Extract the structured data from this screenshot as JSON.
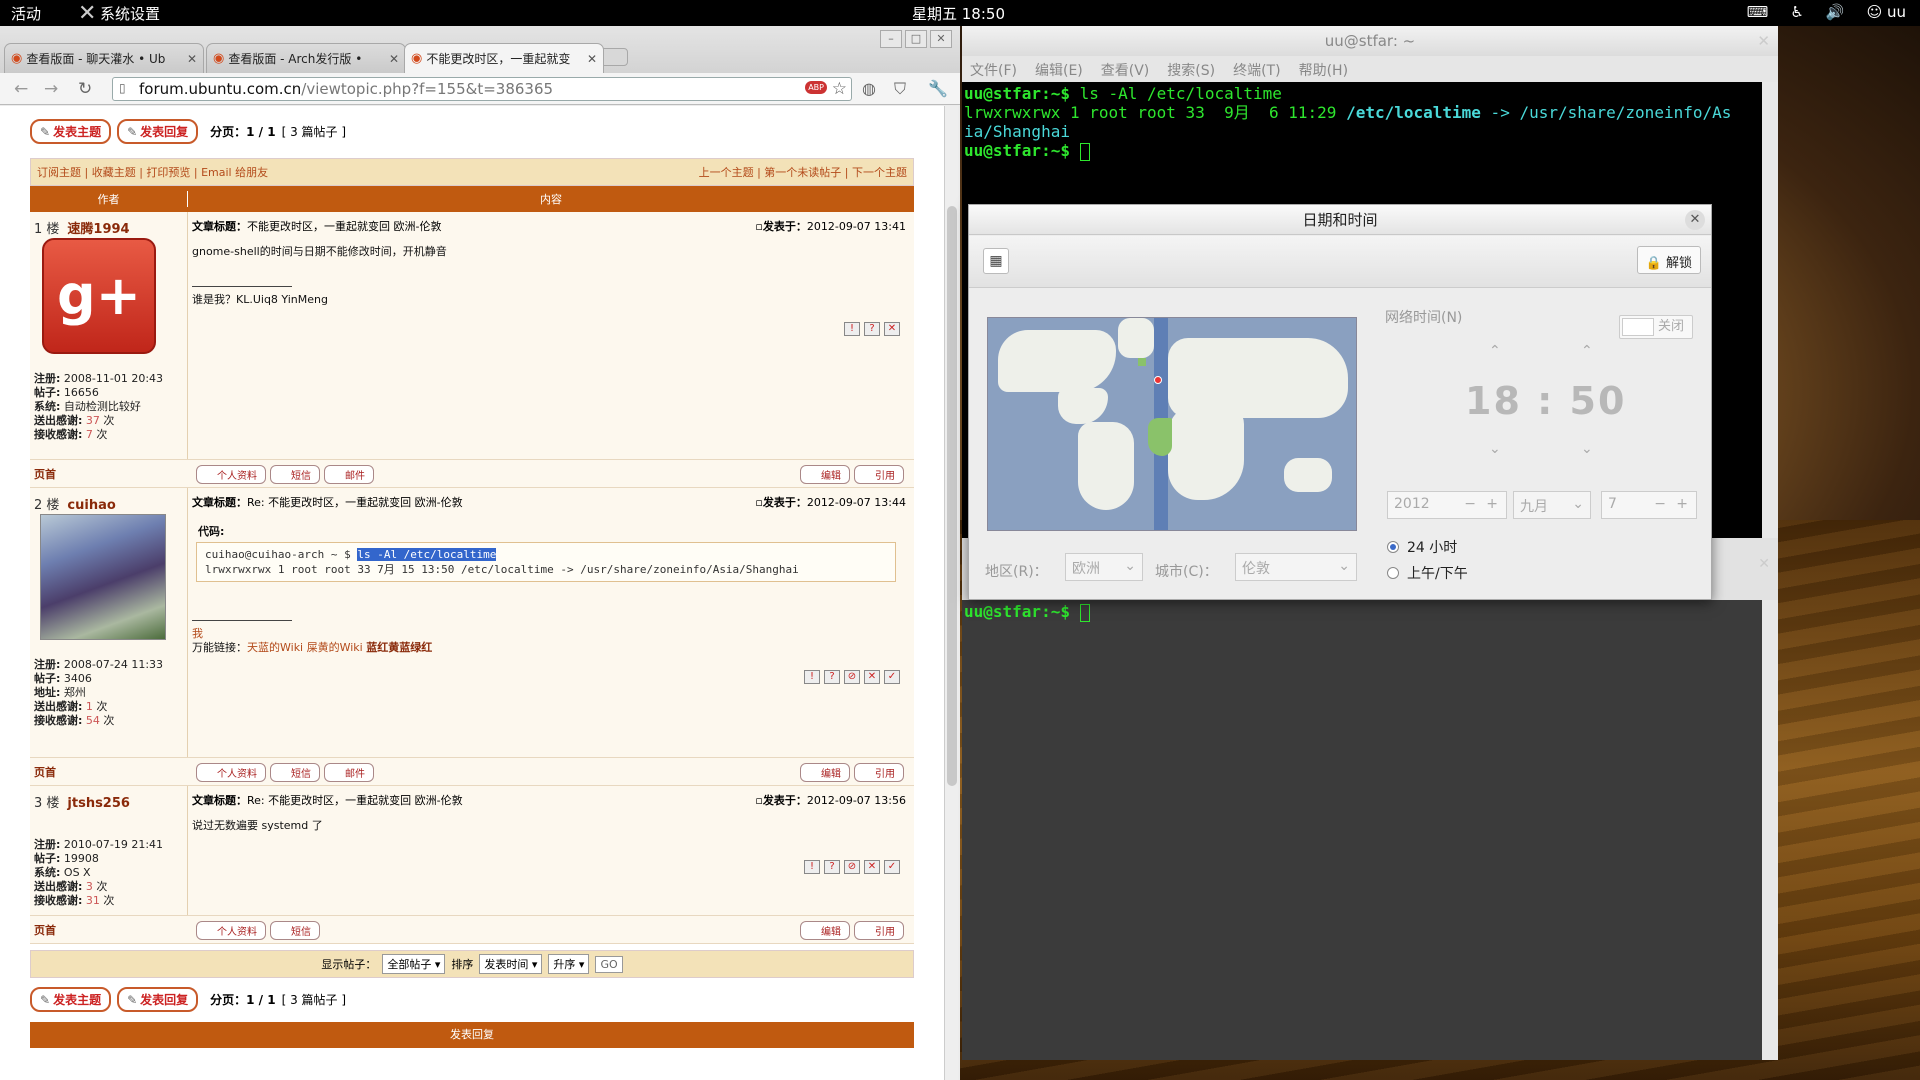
{
  "topbar": {
    "activities": "活动",
    "app_menu": "系统设置",
    "clock": "星期五 18:50",
    "user": "uu"
  },
  "browser": {
    "tabs": [
      {
        "label": "查看版面 - 聊天灌水 • Ub"
      },
      {
        "label": "查看版面 - Arch发行版 •"
      },
      {
        "label": "不能更改时区，一重起就变"
      }
    ],
    "url_host": "forum.ubuntu.com.cn",
    "url_path": "/viewtopic.php?f=155&t=386365"
  },
  "forum": {
    "new_topic": "发表主题",
    "reply": "发表回复",
    "pagination": "分页：1 / 1",
    "post_count": "[ 3 篇帖子 ]",
    "links_left": "订阅主题 | 收藏主题 | 打印预览 | Email 给朋友",
    "links_right": "上一个主题 | 第一个未读帖子 | 下一个主题",
    "col_author": "作者",
    "col_content": "内容",
    "top_link": "页首",
    "btn_profile": "个人资料",
    "btn_pm": "短信",
    "btn_email": "邮件",
    "btn_edit": "编辑",
    "btn_quote": "引用",
    "posts": [
      {
        "floor": "1 楼",
        "user": "速腾1994",
        "title_label": "文章标题：",
        "title": "不能更改时区，一重起就变回 欧洲-伦敦",
        "date_label": "发表于：",
        "date": "2012-09-07 13:41",
        "body": "gnome-shell的时间与日期不能修改时间，开机静音",
        "sig": "谁是我？KL.Uiq8 YinMeng",
        "reg": "2008-11-01 20:43",
        "posts": "16656",
        "os": "自动检测比较好",
        "thanks_given": "37",
        "thanks_recv": "7"
      },
      {
        "floor": "2 楼",
        "user": "cuihao",
        "title_label": "文章标题：",
        "title": "Re: 不能更改时区，一重起就变回 欧洲-伦敦",
        "date_label": "发表于：",
        "date": "2012-09-07 13:44",
        "code_label": "代码:",
        "code_prompt": "cuihao@cuihao-arch ~ $ ",
        "code_cmd": "ls -Al /etc/localtime",
        "code_out": "lrwxrwxrwx 1 root root 33  7月 15 13:50 /etc/localtime -> /usr/share/zoneinfo/Asia/Shanghai",
        "sig1": "我",
        "sig2_label": "万能链接：",
        "sig2_links": "天蓝的Wiki 屎黄的Wiki",
        "sig2_bold": "蓝红黄蓝绿红",
        "reg": "2008-07-24 11:33",
        "posts": "3406",
        "loc": "郑州",
        "thanks_given": "1",
        "thanks_recv": "54"
      },
      {
        "floor": "3 楼",
        "user": "jtshs256",
        "title_label": "文章标题：",
        "title": "Re: 不能更改时区，一重起就变回 欧洲-伦敦",
        "date_label": "发表于：",
        "date": "2012-09-07 13:56",
        "body": "说过无数遍要 systemd 了",
        "reg": "2010-07-19 21:41",
        "posts": "19908",
        "os": "OS X",
        "thanks_given": "3",
        "thanks_recv": "31"
      }
    ],
    "labels": {
      "reg": "注册:",
      "posts": "帖子:",
      "os": "系统:",
      "loc": "地址:",
      "given": "送出感谢:",
      "recv": "接收感谢:",
      "times": "次"
    },
    "display_label": "显示帖子：",
    "display_val": "全部帖子",
    "sort_label": "排序",
    "sort_val": "发表时间",
    "order_val": "升序",
    "go": "GO",
    "reply_header": "发表回复"
  },
  "terminal": {
    "title": "uu@stfar: ~",
    "menu": [
      "文件(F)",
      "编辑(E)",
      "查看(V)",
      "搜索(S)",
      "终端(T)",
      "帮助(H)"
    ],
    "prompt": "uu@stfar:~$ ",
    "cmd": "ls -Al /etc/localtime",
    "out1": "lrwxrwxrwx 1 root root 33  9月  6 11:29 ",
    "out_path": "/etc/localtime",
    "out_target": " -> /usr/share/zoneinfo/As",
    "out2": "ia/Shanghai"
  },
  "datetime": {
    "title": "日期和时间",
    "unlock": "解锁",
    "network_time": "网络时间(N)",
    "toggle_off": "关闭",
    "hour": "18",
    "minute": "50",
    "year": "2012",
    "month": "九月",
    "day": "7",
    "region_label": "地区(R)：",
    "region": "欧洲",
    "city_label": "城市(C)：",
    "city": "伦敦",
    "fmt24": "24 小时",
    "fmt12": "上午/下午"
  }
}
